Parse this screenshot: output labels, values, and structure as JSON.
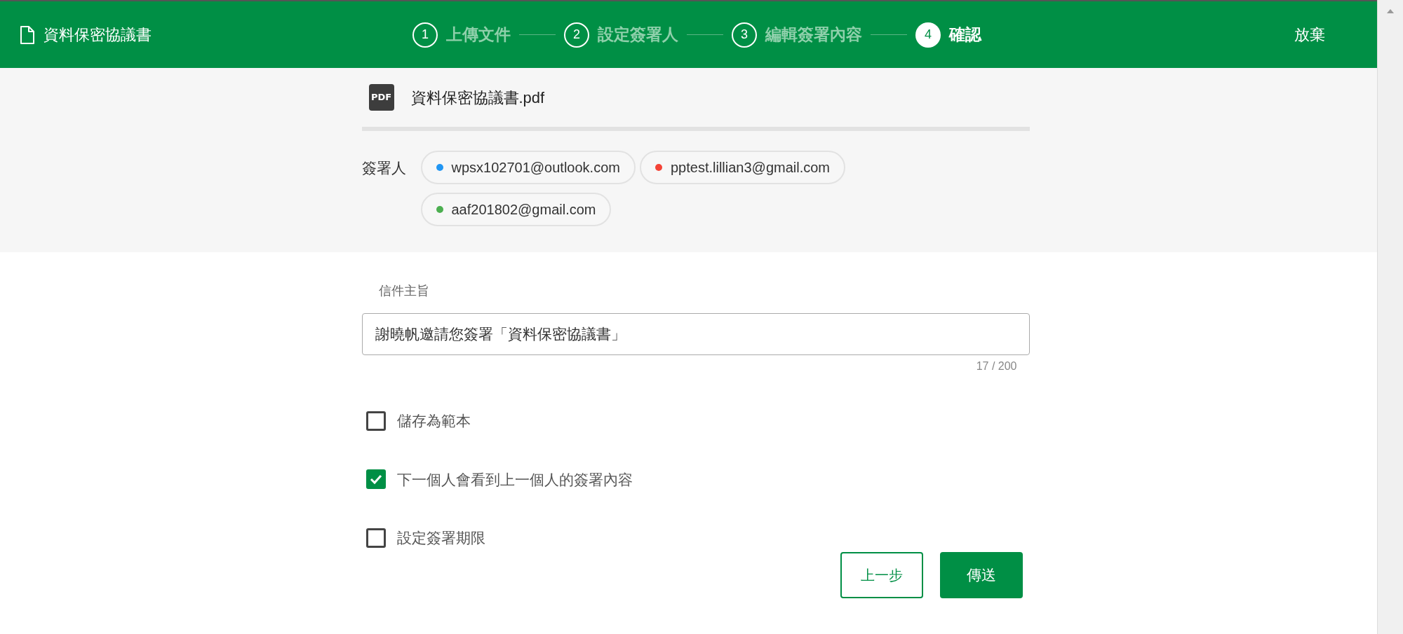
{
  "header": {
    "title": "資料保密協議書",
    "steps": [
      {
        "number": "1",
        "label": "上傳文件",
        "selected": false
      },
      {
        "number": "2",
        "label": "設定簽署人",
        "selected": false
      },
      {
        "number": "3",
        "label": "編輯簽署內容",
        "selected": false
      },
      {
        "number": "4",
        "label": "確認",
        "selected": true
      }
    ],
    "discard": "放棄"
  },
  "file": {
    "icon_text": "PDF",
    "name": "資料保密協議書.pdf"
  },
  "signers": {
    "label": "簽署人",
    "items": [
      {
        "email": "wpsx102701@outlook.com",
        "color": "#2196f3"
      },
      {
        "email": "pptest.lillian3@gmail.com",
        "color": "#f44336"
      },
      {
        "email": "aaf201802@gmail.com",
        "color": "#4caf50"
      }
    ]
  },
  "subject": {
    "label": "信件主旨",
    "value": "謝曉帆邀請您簽署「資料保密協議書」",
    "counter": "17 / 200"
  },
  "options": [
    {
      "label": "儲存為範本",
      "checked": false
    },
    {
      "label": "下一個人會看到上一個人的簽署內容",
      "checked": true
    },
    {
      "label": "設定簽署期限",
      "checked": false
    }
  ],
  "buttons": {
    "back": "上一步",
    "send": "傳送"
  }
}
